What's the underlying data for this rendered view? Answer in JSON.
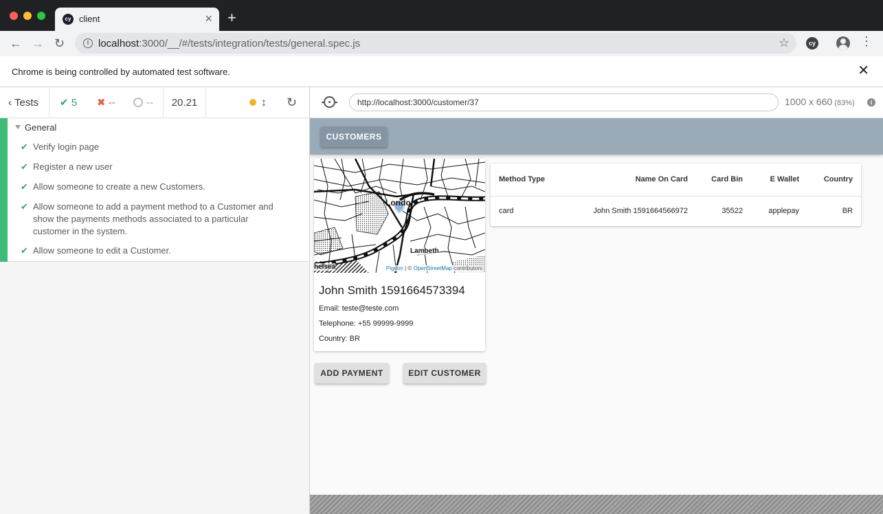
{
  "browser": {
    "tab_title": "client",
    "tab_icon_text": "cy",
    "url_host": "localhost",
    "url_rest": ":3000/__/#/tests/integration/tests/general.spec.js",
    "extension_text": "cy",
    "infobar_text": "Chrome is being controlled by automated test software."
  },
  "reporter": {
    "back_label": "Tests",
    "passed": "5",
    "failed": "--",
    "pending": "--",
    "duration": "20.21",
    "suite_title": "General",
    "tests": [
      {
        "label": "Verify login page"
      },
      {
        "label": "Register a new user"
      },
      {
        "label": "Allow someone to create a new Customers."
      },
      {
        "label": "Allow someone to add a payment method to a Customer and show the payments methods associated to a particular customer in the system."
      },
      {
        "label": "Allow someone to edit a Customer."
      }
    ]
  },
  "runner": {
    "aut_url": "http://localhost:3000/customer/37",
    "viewport": "1000 x 660",
    "scale": "(83%)"
  },
  "app": {
    "customers_button": "CUSTOMERS",
    "map": {
      "label_city": "London",
      "label_area": "Lambeth",
      "label_west": "helsea",
      "attr_pigeon": "Pigeon",
      "attr_sep": " | © ",
      "attr_osm": "OpenStreetMap",
      "attr_tail": " contributors"
    },
    "customer": {
      "name": "John Smith 1591664573394",
      "email": "Email: teste@teste.com",
      "telephone": "Telephone: +55 99999-9999",
      "country": "Country: BR"
    },
    "add_payment_button": "ADD PAYMENT",
    "edit_customer_button": "EDIT CUSTOMER",
    "payments_table": {
      "columns": [
        "Method Type",
        "Name On Card",
        "Card Bin",
        "E Wallet",
        "Country"
      ],
      "rows": [
        [
          "card",
          "John Smith 1591664566972",
          "35522",
          "applepay",
          "BR"
        ]
      ]
    }
  }
}
